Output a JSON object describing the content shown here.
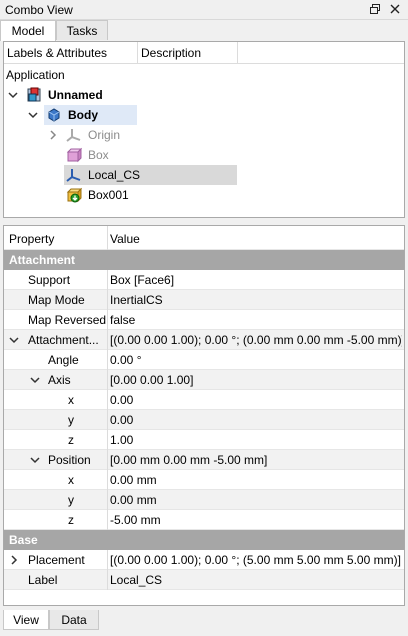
{
  "window": {
    "title": "Combo View"
  },
  "top_tabs": [
    "Model",
    "Tasks"
  ],
  "tree": {
    "col_labels": "Labels & Attributes",
    "col_description": "Description",
    "section": "Application",
    "items": [
      {
        "label": "Unnamed",
        "icon": "document-icon",
        "bold": true
      },
      {
        "label": "Body",
        "icon": "body-icon",
        "bold": true
      },
      {
        "label": "Origin",
        "icon": "origin-icon",
        "muted": true
      },
      {
        "label": "Box",
        "icon": "box-icon",
        "muted": true
      },
      {
        "label": "Local_CS",
        "icon": "coordinate-system-icon",
        "selected": true
      },
      {
        "label": "Box001",
        "icon": "box-icon"
      }
    ]
  },
  "props": {
    "col_property": "Property",
    "col_value": "Value",
    "group_attachment": "Attachment",
    "support": {
      "name": "Support",
      "value": "Box [Face6]"
    },
    "map_mode": {
      "name": "Map Mode",
      "value": "InertialCS"
    },
    "map_reversed": {
      "name": "Map Reversed",
      "value": "false"
    },
    "attachment": {
      "name": "Attachment...",
      "value": "[(0.00 0.00 1.00); 0.00 °; (0.00 mm  0.00 mm  -5.00 mm)]"
    },
    "angle": {
      "name": "Angle",
      "value": "0.00 °"
    },
    "axis": {
      "name": "Axis",
      "value": "[0.00 0.00 1.00]"
    },
    "axis_x": {
      "name": "x",
      "value": "0.00"
    },
    "axis_y": {
      "name": "y",
      "value": "0.00"
    },
    "axis_z": {
      "name": "z",
      "value": "1.00"
    },
    "position": {
      "name": "Position",
      "value": "[0.00 mm  0.00 mm  -5.00 mm]"
    },
    "pos_x": {
      "name": "x",
      "value": "0.00 mm"
    },
    "pos_y": {
      "name": "y",
      "value": "0.00 mm"
    },
    "pos_z": {
      "name": "z",
      "value": "-5.00 mm"
    },
    "group_base": "Base",
    "placement": {
      "name": "Placement",
      "value": "[(0.00 0.00 1.00); 0.00 °; (5.00 mm  5.00 mm  5.00 mm)]"
    },
    "label": {
      "name": "Label",
      "value": "Local_CS"
    }
  },
  "bottom_tabs": [
    "View",
    "Data"
  ],
  "colors": {
    "selection": "#cce8ff",
    "group": "#a6a6a6",
    "muted": "#8c8c8c"
  }
}
